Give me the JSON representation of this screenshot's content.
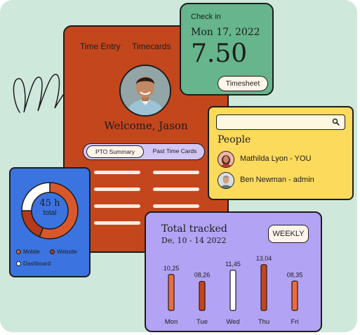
{
  "main_card": {
    "tabs": [
      "Time Entry",
      "Timecards"
    ],
    "welcome": "Welcome, Jason",
    "pill_tabs": [
      "PTO Summary",
      "Past Time Cards"
    ],
    "colors": {
      "card": "#c4461c",
      "accent": "#d3c6f4"
    }
  },
  "checkin": {
    "label": "Check in",
    "date": "Mon 17, 2022",
    "hours": "7.50",
    "button": "Timesheet"
  },
  "people": {
    "search_icon": "search-icon",
    "title": "People",
    "list": [
      {
        "name": "Mathilda Lyon - YOU"
      },
      {
        "name": "Ben Newman - admin"
      }
    ]
  },
  "donut": {
    "hours": "45 h",
    "sub": "total",
    "legend": [
      "Mobile",
      "Website",
      "Dashboard"
    ],
    "slices": [
      {
        "label": "Mobile",
        "fraction": 0.56,
        "color": "#d9582b"
      },
      {
        "label": "Website",
        "fraction": 0.19,
        "color": "#b5391a"
      },
      {
        "label": "Dashboard",
        "fraction": 0.25,
        "color": "#ffffff"
      }
    ]
  },
  "tracked": {
    "title": "Total tracked",
    "subtitle": "De, 10 - 14 2022",
    "weekly_button": "WEEKLY"
  },
  "chart_data": {
    "type": "bar",
    "categories": [
      "Mon",
      "Tue",
      "Wed",
      "Thu",
      "Fri"
    ],
    "values": [
      10.25,
      8.26,
      11.45,
      13.04,
      8.35
    ],
    "value_labels": [
      "10,25",
      "08,26",
      "11,45",
      "13,04",
      "08,35"
    ],
    "colors": [
      "#ec6c3f",
      "#c4461c",
      "#ffffff",
      "#c4461c",
      "#ec6c3f"
    ],
    "title": "Total tracked",
    "xlabel": "",
    "ylabel": "",
    "ylim": [
      0,
      14
    ]
  }
}
